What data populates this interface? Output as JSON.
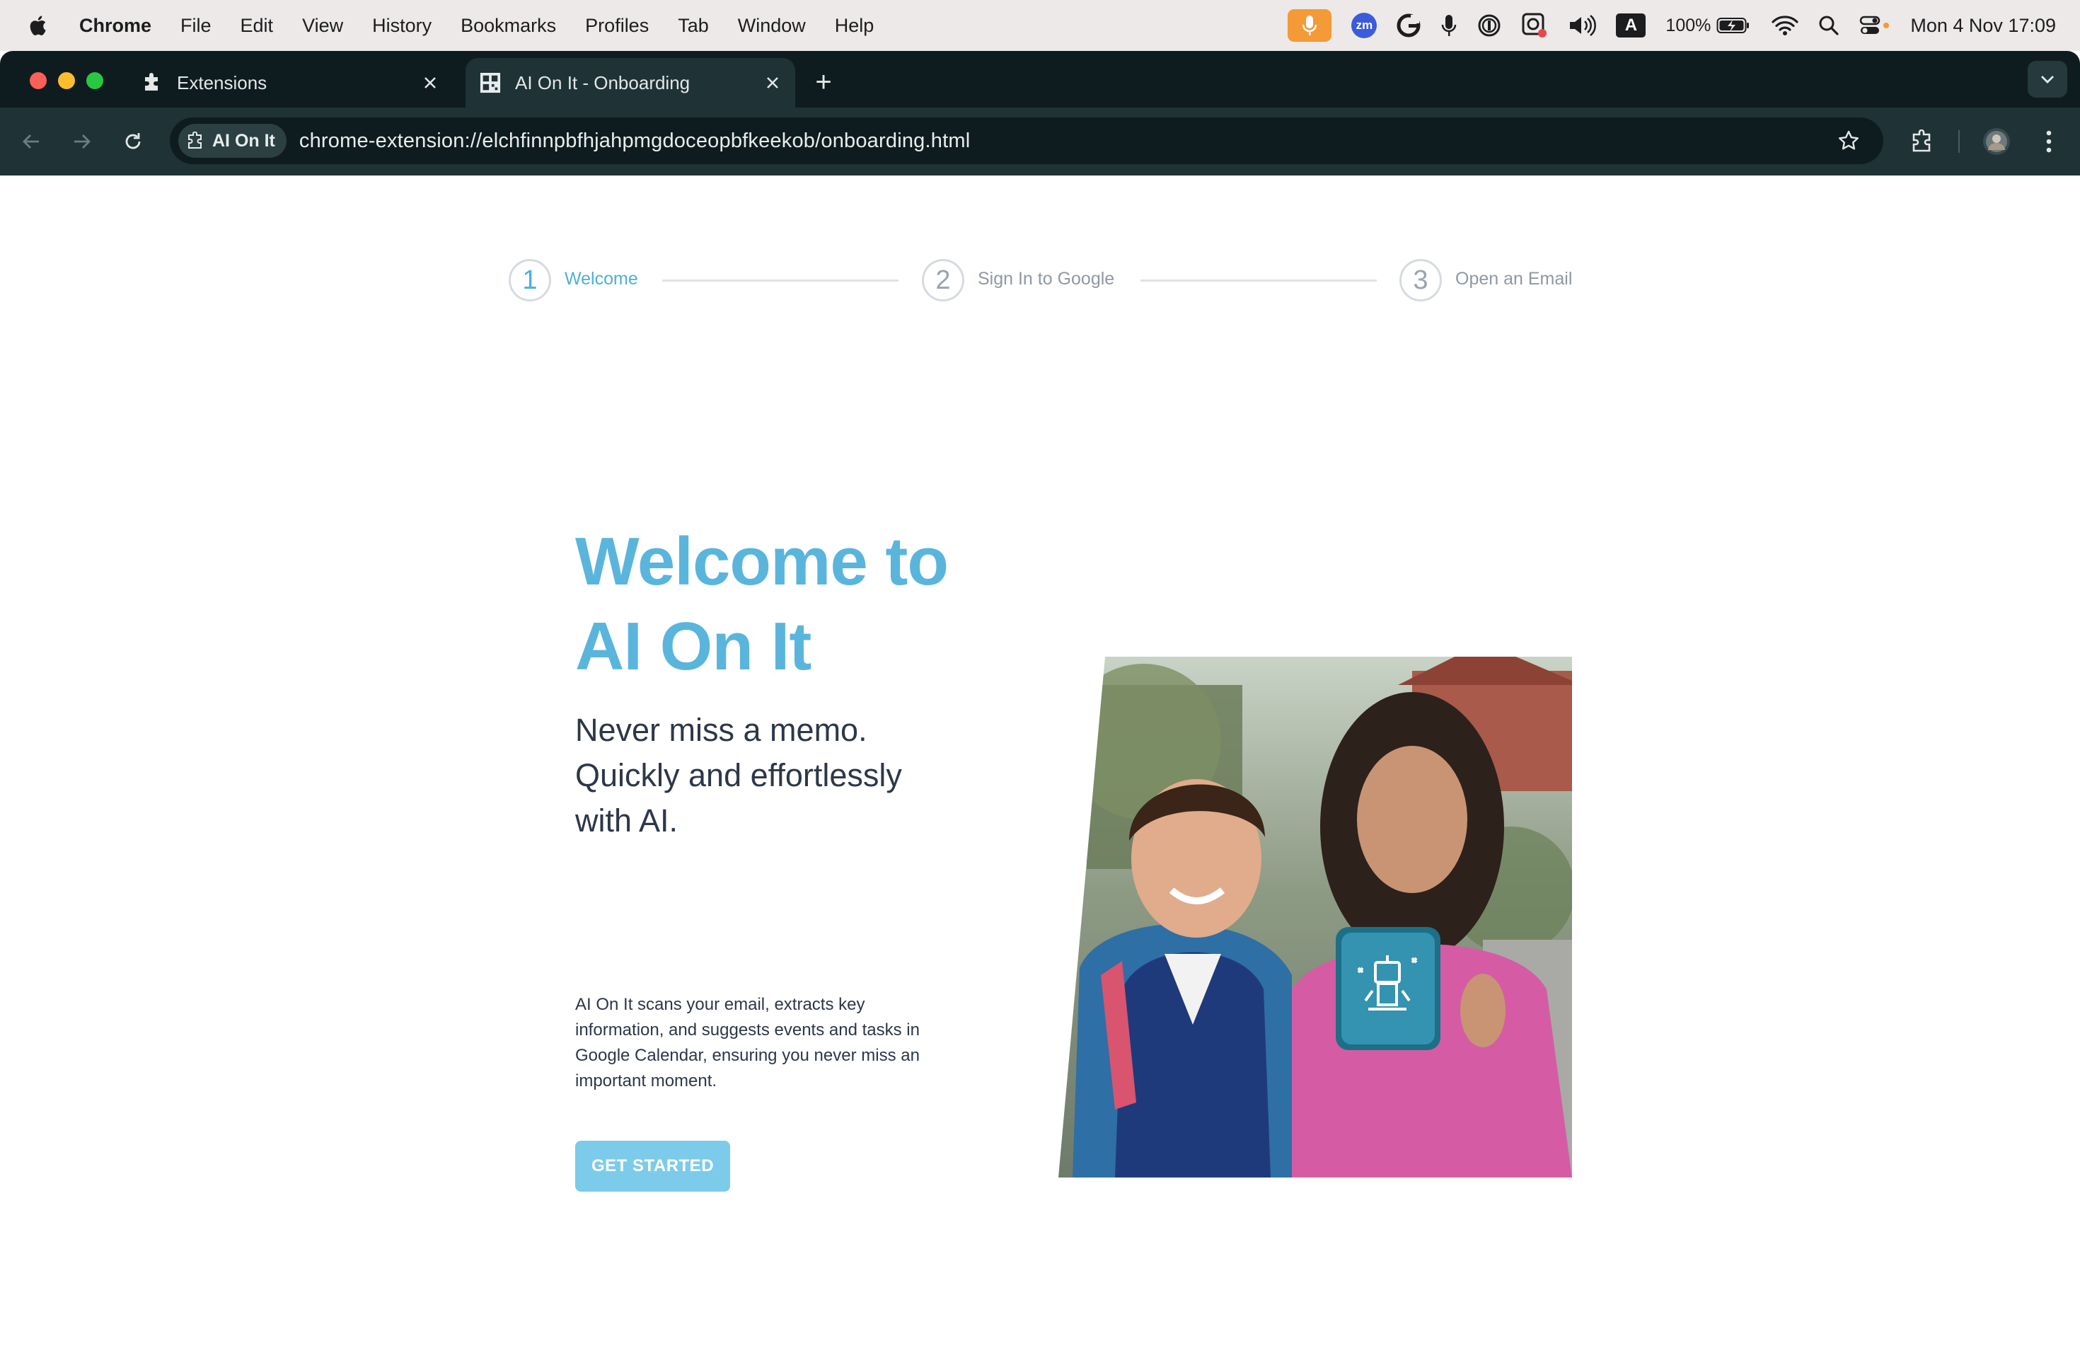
{
  "menubar": {
    "app_name": "Chrome",
    "items": [
      "File",
      "Edit",
      "View",
      "History",
      "Bookmarks",
      "Profiles",
      "Tab",
      "Window",
      "Help"
    ],
    "zoom_icon_label": "zm",
    "input_source": "A",
    "battery": "100%",
    "clock": "Mon 4 Nov  17:09"
  },
  "browser": {
    "tabs": [
      {
        "title": "Extensions",
        "icon": "puzzle-icon",
        "active": false
      },
      {
        "title": "AI On It - Onboarding",
        "icon": "ai-on-it-favicon",
        "active": true
      }
    ],
    "new_tab_label": "+",
    "site_chip": "AI On It",
    "url": "chrome-extension://elchfinnpbfhjahpmgdoceopbfkeekob/onboarding.html"
  },
  "onboarding": {
    "steps": [
      {
        "number": "1",
        "label": "Welcome",
        "active": true
      },
      {
        "number": "2",
        "label": "Sign In to Google",
        "active": false
      },
      {
        "number": "3",
        "label": "Open an Email",
        "active": false
      }
    ],
    "title_line1": "Welcome to",
    "title_line2": "AI On It",
    "subtitle_lines": [
      "Never miss a memo.",
      "Quickly and effortlessly",
      "with AI."
    ],
    "description_lines": [
      "AI On It scans your email, extracts key",
      "information, and suggests events and tasks in",
      "Google Calendar, ensuring you never miss an",
      "important moment."
    ],
    "cta_label": "GET STARTED"
  },
  "colors": {
    "accent": "#5ab5dc",
    "cta": "#7ccbea",
    "browser_frame": "#0f1c1f",
    "toolbar": "#1f3236"
  }
}
